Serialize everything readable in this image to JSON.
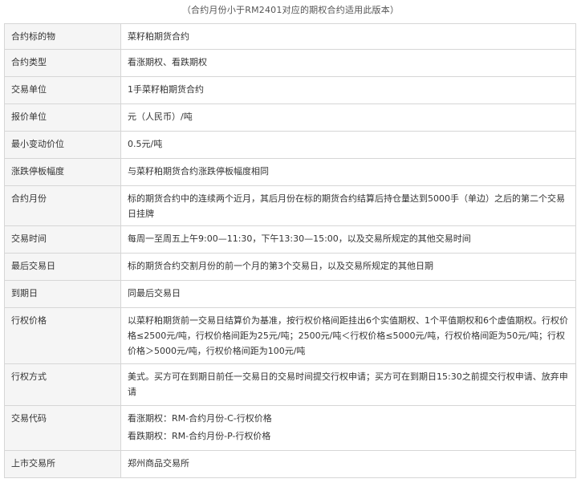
{
  "caption": "（合约月份小于RM2401对应的期权合约适用此版本）",
  "rows": [
    {
      "key": "合约标的物",
      "value": "菜籽粕期货合约"
    },
    {
      "key": "合约类型",
      "value": "看涨期权、看跌期权"
    },
    {
      "key": "交易单位",
      "value": "1手菜籽粕期货合约"
    },
    {
      "key": "报价单位",
      "value": "元（人民币）/吨"
    },
    {
      "key": "最小变动价位",
      "value": "0.5元/吨"
    },
    {
      "key": "涨跌停板幅度",
      "value": "与菜籽粕期货合约涨跌停板幅度相同"
    },
    {
      "key": "合约月份",
      "value": "标的期货合约中的连续两个近月，其后月份在标的期货合约结算后持仓量达到5000手（单边）之后的第二个交易日挂牌"
    },
    {
      "key": "交易时间",
      "value": "每周一至周五上午9:00—11:30，下午13:30—15:00，以及交易所规定的其他交易时间"
    },
    {
      "key": "最后交易日",
      "value": "标的期货合约交割月份的前一个月的第3个交易日，以及交易所规定的其他日期"
    },
    {
      "key": "到期日",
      "value": "同最后交易日"
    },
    {
      "key": "行权价格",
      "value": "以菜籽粕期货前一交易日结算价为基准，按行权价格间距挂出6个实值期权、1个平值期权和6个虚值期权。行权价格≤2500元/吨，行权价格间距为25元/吨；2500元/吨＜行权价格≤5000元/吨，行权价格间距为50元/吨；行权价格＞5000元/吨，行权价格间距为100元/吨"
    },
    {
      "key": "行权方式",
      "value": "美式。买方可在到期日前任一交易日的交易时间提交行权申请；买方可在到期日15:30之前提交行权申请、放弃申请"
    },
    {
      "key": "交易代码",
      "value": "看涨期权：RM-合约月份-C-行权价格",
      "value2": "看跌期权：RM-合约月份-P-行权价格"
    },
    {
      "key": "上市交易所",
      "value": "郑州商品交易所"
    }
  ]
}
